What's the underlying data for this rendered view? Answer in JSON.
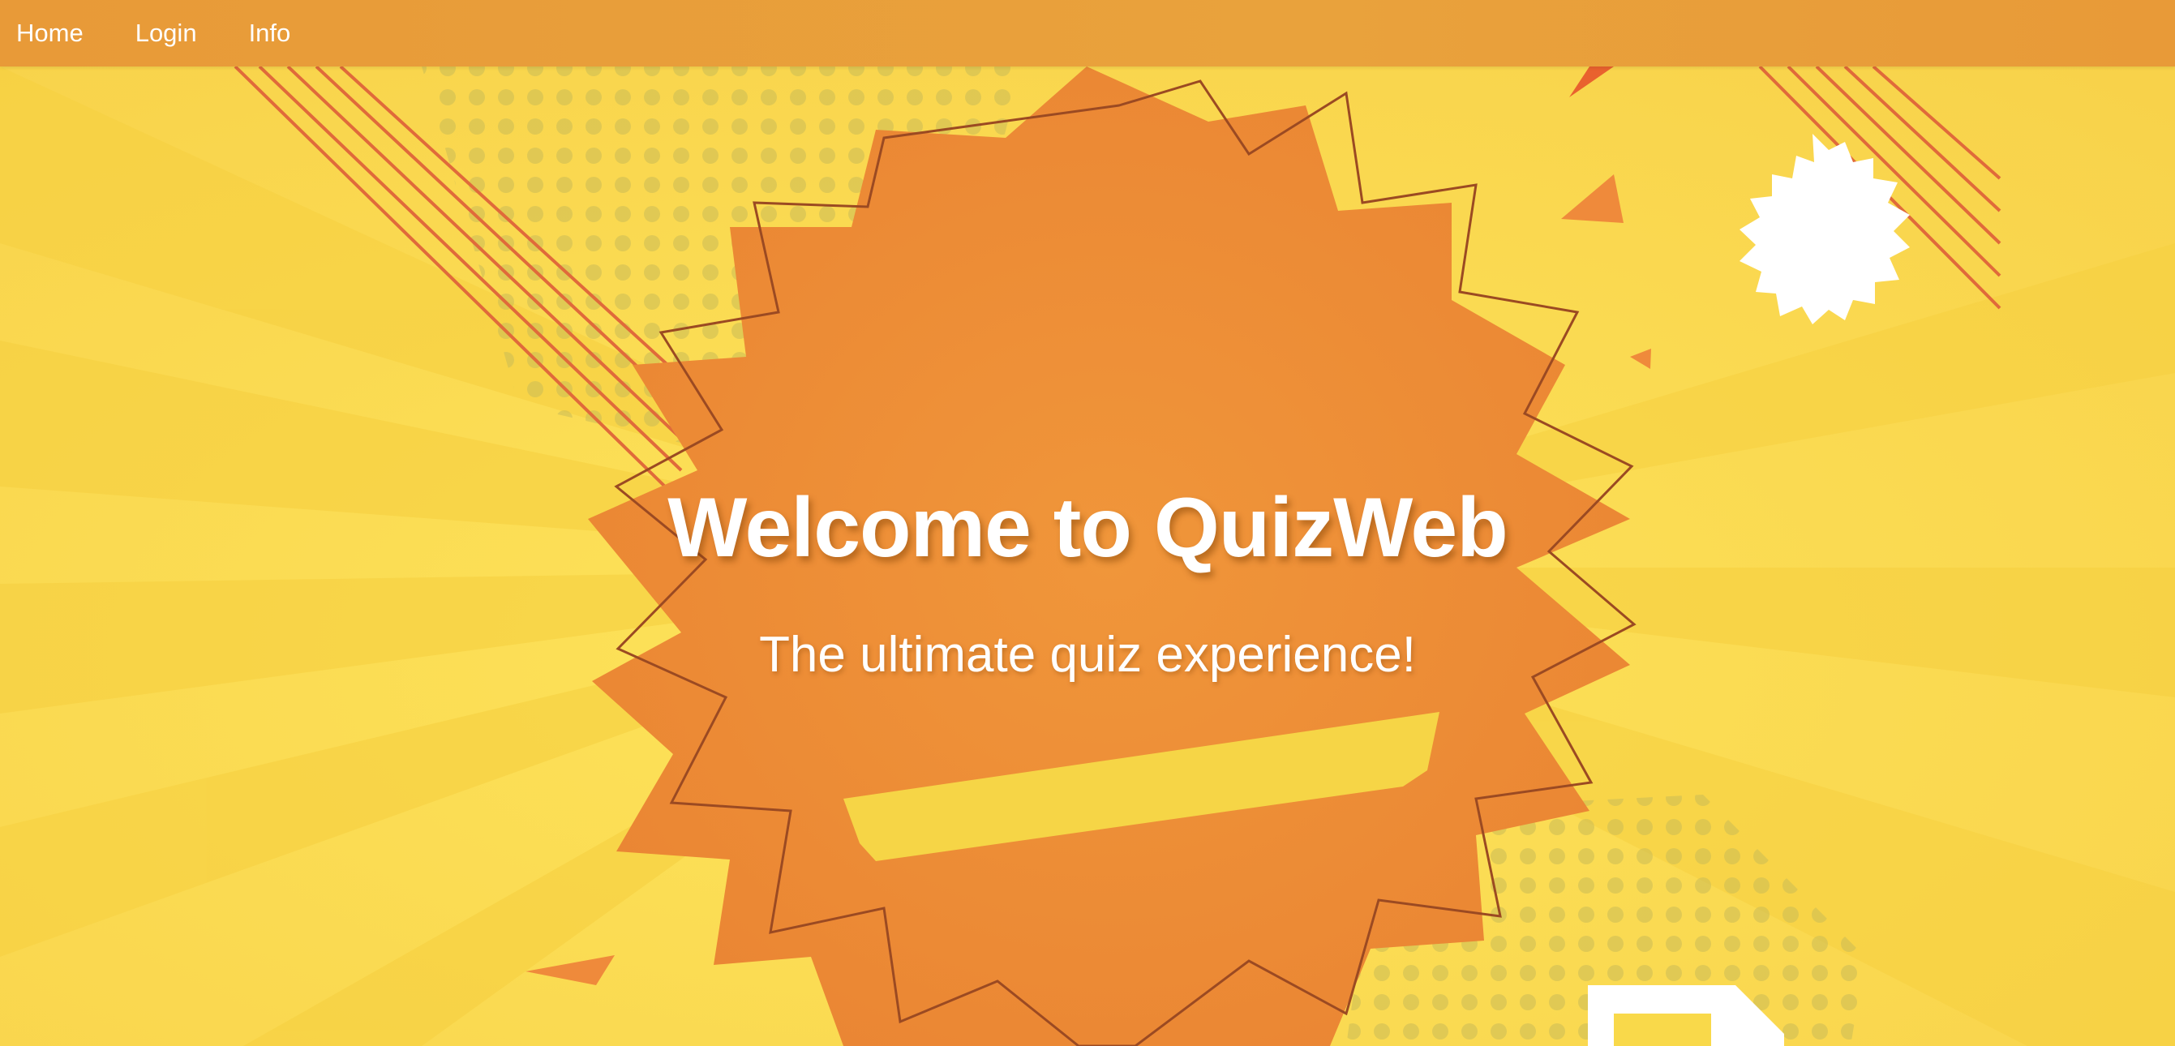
{
  "nav": {
    "items": [
      {
        "label": "Home"
      },
      {
        "label": "Login"
      },
      {
        "label": "Info"
      }
    ]
  },
  "hero": {
    "title": "Welcome to QuizWeb",
    "subtitle": "The ultimate quiz experience!",
    "background_icon": "comic-starburst-background"
  },
  "colors": {
    "navbar": "#e89a38",
    "background": "#fbe14d",
    "starburst": "#ec8a34",
    "text": "#ffffff"
  }
}
